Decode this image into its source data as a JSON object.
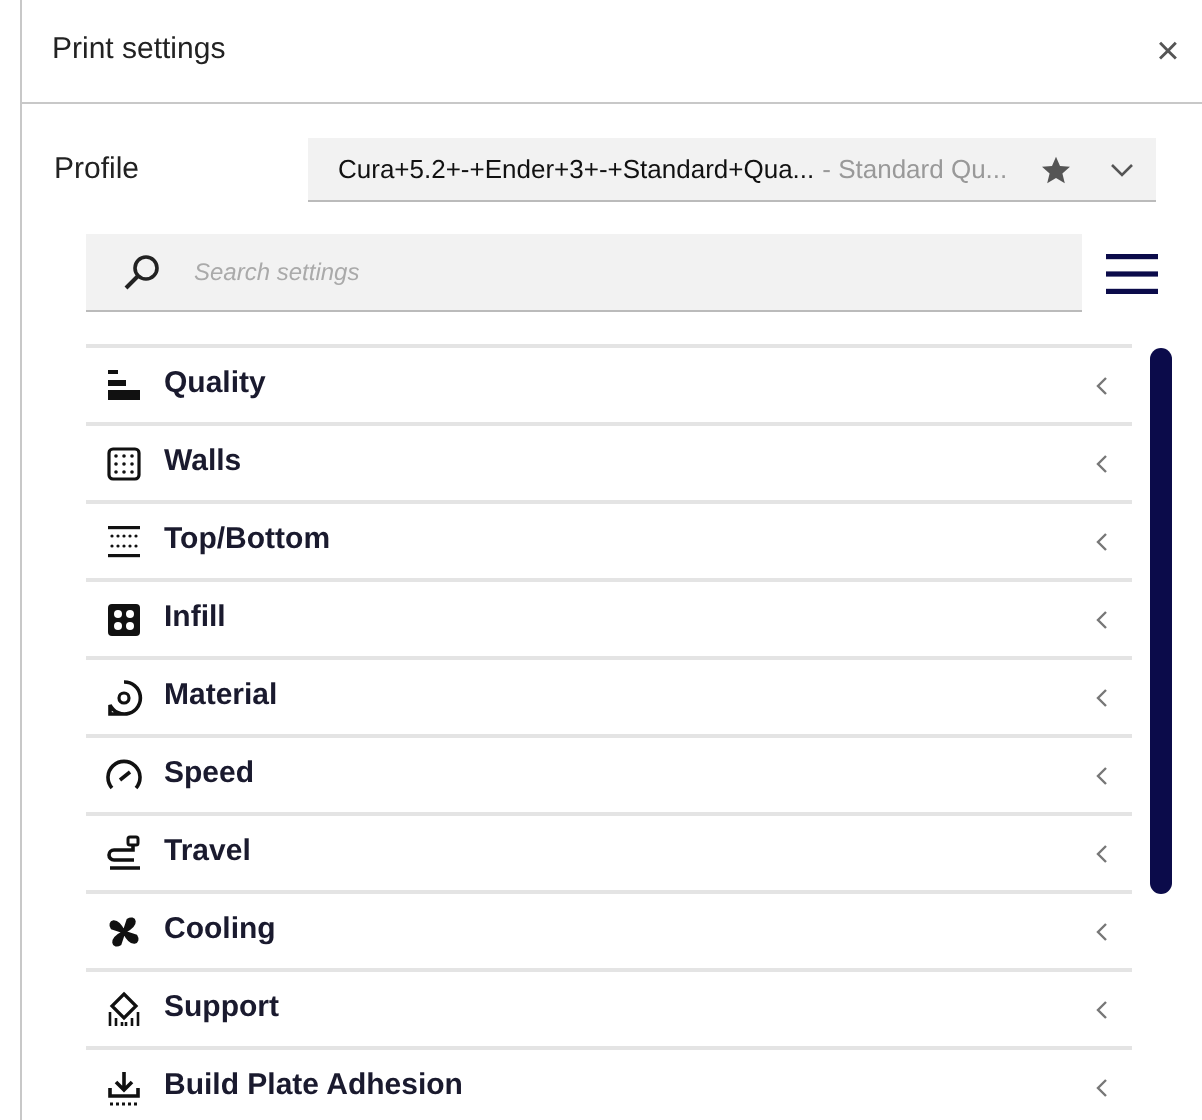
{
  "panel": {
    "title": "Print settings",
    "close": "×"
  },
  "profile": {
    "label": "Profile",
    "name": "Cura+5.2+-+Ender+3+-+Standard+Qua...",
    "quality": "- Standard Qu..."
  },
  "search": {
    "placeholder": "Search settings"
  },
  "categories": [
    {
      "label": "Quality"
    },
    {
      "label": "Walls"
    },
    {
      "label": "Top/Bottom"
    },
    {
      "label": "Infill"
    },
    {
      "label": "Material"
    },
    {
      "label": "Speed"
    },
    {
      "label": "Travel"
    },
    {
      "label": "Cooling"
    },
    {
      "label": "Support"
    },
    {
      "label": "Build Plate Adhesion"
    }
  ]
}
